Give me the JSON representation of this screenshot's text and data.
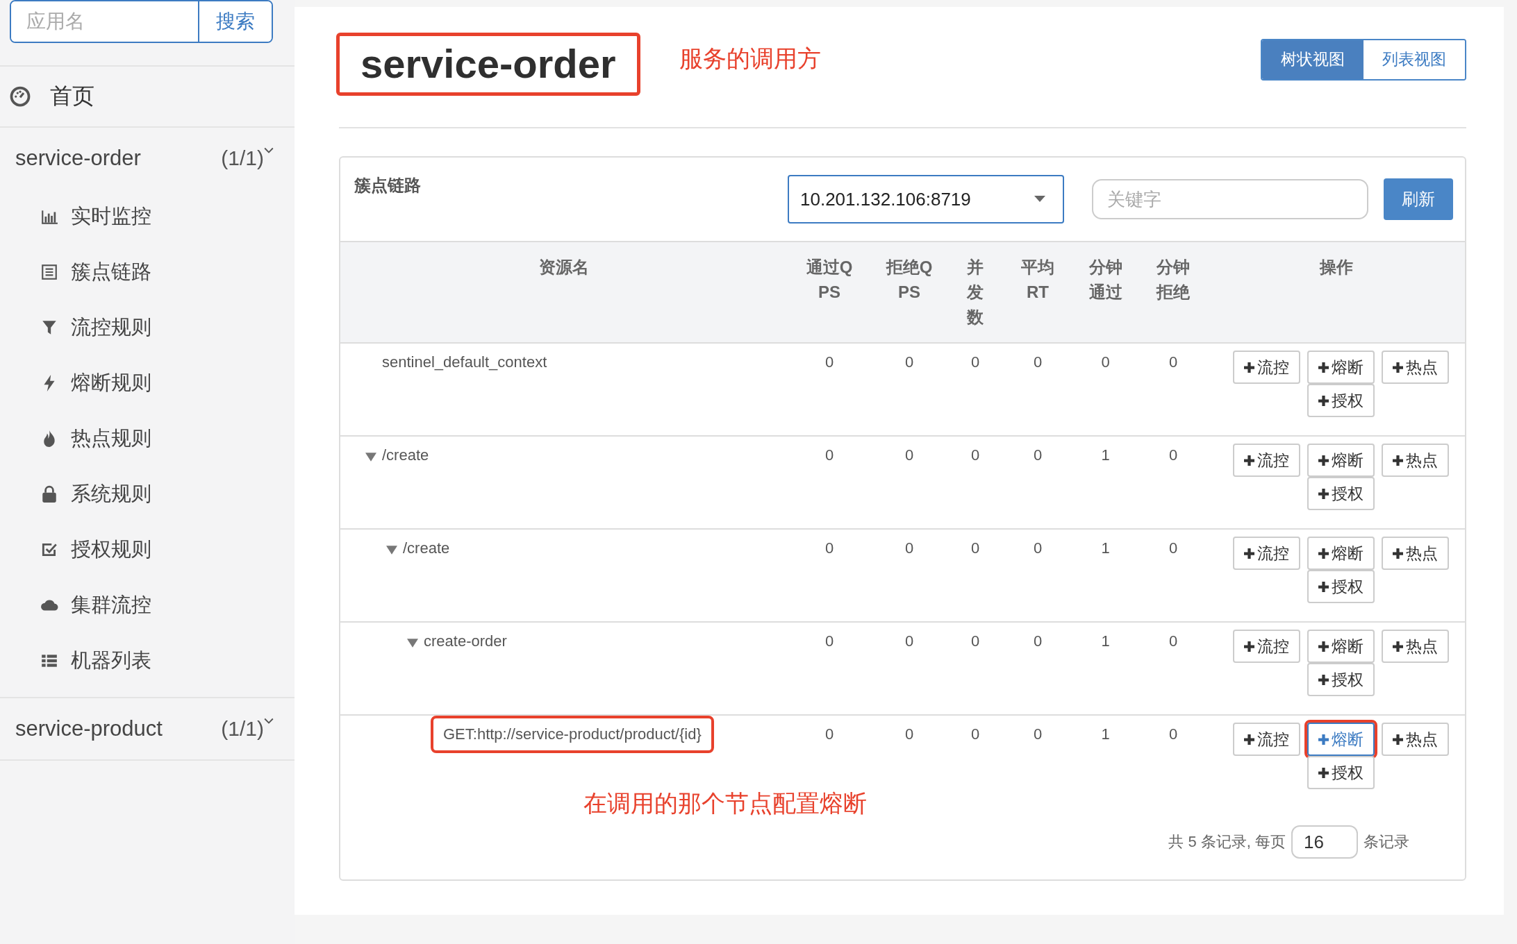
{
  "sidebar": {
    "search": {
      "placeholder": "应用名",
      "button": "搜索"
    },
    "home": "首页",
    "apps": [
      {
        "name": "service-order",
        "count": "(1/1)",
        "menu": [
          "实时监控",
          "簇点链路",
          "流控规则",
          "熔断规则",
          "热点规则",
          "系统规则",
          "授权规则",
          "集群流控",
          "机器列表"
        ]
      },
      {
        "name": "service-product",
        "count": "(1/1)"
      }
    ]
  },
  "header": {
    "title": "service-order",
    "title_marked": true,
    "note": "服务的调用方",
    "views": [
      {
        "label": "树状视图",
        "selected": true
      },
      {
        "label": "列表视图",
        "selected": false
      }
    ]
  },
  "panel": {
    "title": "簇点链路",
    "machine": "10.201.132.106:8719",
    "keyword_placeholder": "关键字",
    "refresh": "刷新",
    "columns": [
      "资源名",
      "通过QPS",
      "拒绝QPS",
      "并发数",
      "平均RT",
      "分钟通过",
      "分钟拒绝",
      "操作"
    ],
    "rows": [
      {
        "name": "sentinel_default_context",
        "marked": false,
        "values": [
          "0",
          "0",
          "0",
          "0",
          "0",
          "0"
        ],
        "actions": [
          {
            "label": "流控",
            "marked": false
          },
          {
            "label": "熔断",
            "marked": false
          },
          {
            "label": "热点",
            "marked": false
          },
          {
            "label": "授权",
            "marked": false
          }
        ]
      },
      {
        "name": "/create",
        "marked": false,
        "expanded": true,
        "values": [
          "0",
          "0",
          "0",
          "0",
          "1",
          "0"
        ],
        "actions": [
          {
            "label": "流控",
            "marked": false
          },
          {
            "label": "熔断",
            "marked": false
          },
          {
            "label": "热点",
            "marked": false
          },
          {
            "label": "授权",
            "marked": false
          }
        ],
        "children": [
          {
            "name": "/create",
            "marked": false,
            "expanded": true,
            "values": [
              "0",
              "0",
              "0",
              "0",
              "1",
              "0"
            ],
            "actions": [
              {
                "label": "流控",
                "marked": false
              },
              {
                "label": "熔断",
                "marked": false
              },
              {
                "label": "热点",
                "marked": false
              },
              {
                "label": "授权",
                "marked": false
              }
            ],
            "children": [
              {
                "name": "create-order",
                "marked": false,
                "expanded": true,
                "values": [
                  "0",
                  "0",
                  "0",
                  "0",
                  "1",
                  "0"
                ],
                "actions": [
                  {
                    "label": "流控",
                    "marked": false
                  },
                  {
                    "label": "熔断",
                    "marked": false
                  },
                  {
                    "label": "热点",
                    "marked": false
                  },
                  {
                    "label": "授权",
                    "marked": false
                  }
                ],
                "children": [
                  {
                    "name": "GET:http://service-product/product/{id}",
                    "marked": true,
                    "values": [
                      "0",
                      "0",
                      "0",
                      "0",
                      "1",
                      "0"
                    ],
                    "actions": [
                      {
                        "label": "流控",
                        "marked": false
                      },
                      {
                        "label": "熔断",
                        "marked": true
                      },
                      {
                        "label": "热点",
                        "marked": false
                      },
                      {
                        "label": "授权",
                        "marked": false
                      }
                    ]
                  }
                ]
              }
            ]
          }
        ]
      }
    ],
    "note": "在调用的那个节点配置熔断",
    "pagination": {
      "summary": "共 5 条记录, 每页",
      "page_size": "16",
      "suffix": "条记录"
    }
  }
}
